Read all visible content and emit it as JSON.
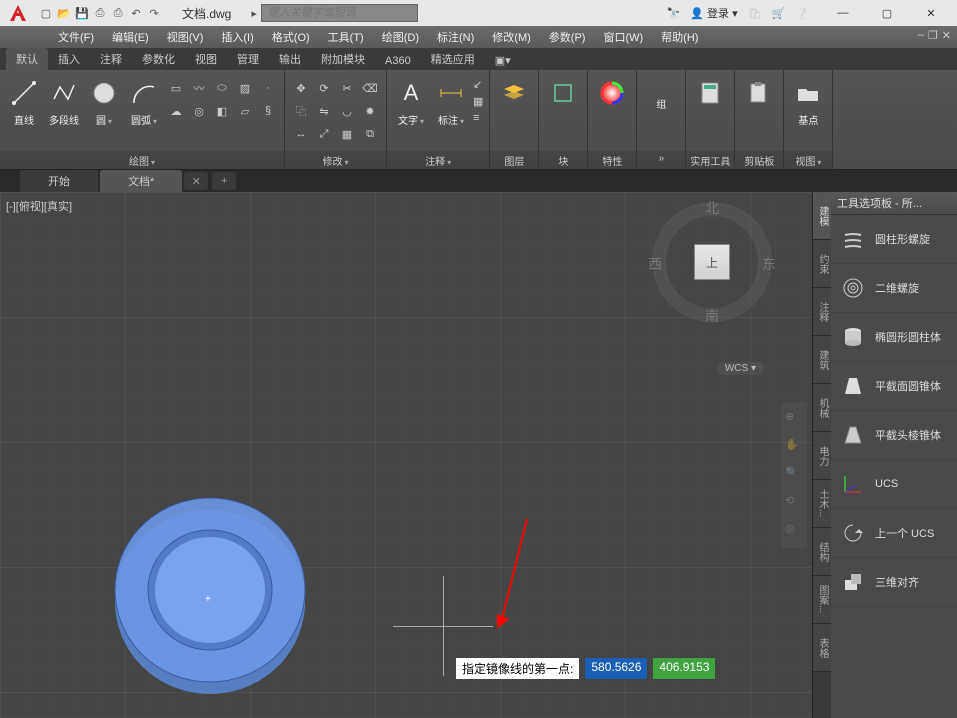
{
  "titlebar": {
    "filename": "文档.dwg",
    "search_placeholder": "键入关键字或短语",
    "login": "登录"
  },
  "menus": {
    "file": "文件(F)",
    "edit": "编辑(E)",
    "view": "视图(V)",
    "insert": "插入(I)",
    "format": "格式(O)",
    "tools": "工具(T)",
    "draw": "绘图(D)",
    "dimension": "标注(N)",
    "modify": "修改(M)",
    "params": "参数(P)",
    "window": "窗口(W)",
    "help": "帮助(H)"
  },
  "ribbon_tabs": {
    "default": "默认",
    "insert": "插入",
    "annotate": "注释",
    "parametric": "参数化",
    "view": "视图",
    "manage": "管理",
    "output": "输出",
    "addins": "附加模块",
    "a360": "A360",
    "featured": "精选应用"
  },
  "ribbon": {
    "draw": {
      "line": "直线",
      "polyline": "多段线",
      "circle": "圆",
      "arc": "圆弧",
      "panel_title": "绘图"
    },
    "modify": {
      "panel_title": "修改"
    },
    "annotation": {
      "text": "文字",
      "dim": "标注",
      "panel_title": "注释"
    },
    "layer": {
      "panel_title": "图层"
    },
    "block": {
      "panel_title": "块"
    },
    "properties": {
      "panel_title": "特性"
    },
    "group": {
      "panel_title": "组"
    },
    "utilities": {
      "panel_title": "实用工具"
    },
    "clipboard": {
      "panel_title": "剪贴板"
    },
    "base": {
      "panel_title": "基点",
      "view": "视图"
    }
  },
  "drawing_tabs": {
    "start": "开始",
    "doc": "文档*"
  },
  "viewport": {
    "label": "[-][俯视][真实]"
  },
  "viewcube": {
    "face": "上",
    "n": "北",
    "s": "南",
    "e": "东",
    "w": "西",
    "wcs": "WCS"
  },
  "dynamic_input": {
    "prompt": "指定镜像线的第一点:",
    "x": "580.5626",
    "y": "406.9153"
  },
  "palette": {
    "title": "工具选项板 - 所...",
    "tabs": {
      "modeling": "建模",
      "constraint": "约束",
      "annot": "注释",
      "arch": "建筑",
      "mech": "机械",
      "elec": "电力",
      "civil": "土木...",
      "struct": "结构",
      "planar": "图案...",
      "tables": "表格"
    },
    "items": {
      "helix": "圆柱形螺旋",
      "spiral": "二维螺旋",
      "cylinder": "椭圆形圆柱体",
      "cone": "平截面圆锥体",
      "pyramid": "平截头棱锥体",
      "ucs": "UCS",
      "prev_ucs": "上一个 UCS",
      "align3d": "三维对齐"
    }
  }
}
